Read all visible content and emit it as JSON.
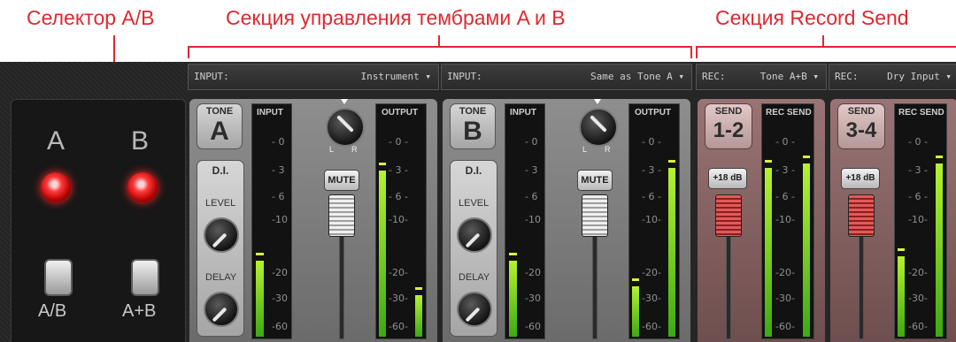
{
  "annotations": {
    "selector": "Селектор A/B",
    "tone_section": "Секция управления тембрами A и B",
    "rec_section": "Секция Record Send"
  },
  "selector": {
    "label_a": "A",
    "label_b": "B",
    "switch_ab": "A/B",
    "switch_aplusb": "A+B",
    "led_color": "#ff3b3b"
  },
  "channels": [
    {
      "input_label": "INPUT:",
      "input_value": "Instrument",
      "tag": "TONE",
      "letter": "A",
      "di": "D.I.",
      "level": "LEVEL",
      "delay": "DELAY",
      "meter_in": "INPUT",
      "meter_out": "OUTPUT",
      "mute": "MUTE",
      "pan_l": "L",
      "pan_r": "R",
      "input_level": 0.33,
      "output_level_l": 0.72,
      "output_level_r": 0.18
    },
    {
      "input_label": "INPUT:",
      "input_value": "Same as Tone A",
      "tag": "TONE",
      "letter": "B",
      "di": "D.I.",
      "level": "LEVEL",
      "delay": "DELAY",
      "meter_in": "INPUT",
      "meter_out": "OUTPUT",
      "mute": "MUTE",
      "pan_l": "L",
      "pan_r": "R",
      "input_level": 0.33,
      "output_level_l": 0.22,
      "output_level_r": 0.73
    }
  ],
  "sends": [
    {
      "rec_label": "REC:",
      "rec_value": "Tone A+B",
      "tag": "SEND",
      "number": "1-2",
      "gain": "+18 dB",
      "meter": "REC SEND",
      "level_l": 0.73,
      "level_r": 0.75
    },
    {
      "rec_label": "REC:",
      "rec_value": "Dry Input",
      "tag": "SEND",
      "number": "3-4",
      "gain": "+18 dB",
      "meter": "REC SEND",
      "level_l": 0.35,
      "level_r": 0.75
    }
  ],
  "scale": {
    "s0": "- 0 -",
    "s3": "- 3 -",
    "s6": "- 6 -",
    "s10": "-10-",
    "s20": "-20-",
    "s30": "-30-",
    "s60": "-60-",
    "i0": "- 0",
    "i3": "- 3",
    "i6": "- 6",
    "i10": "-10",
    "i20": "-20",
    "i30": "-30",
    "i60": "-60"
  }
}
